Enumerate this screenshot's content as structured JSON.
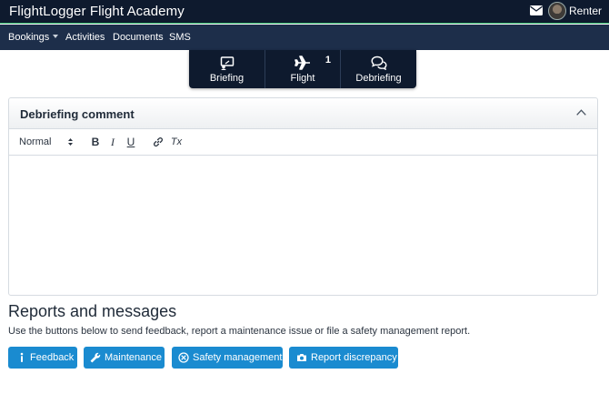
{
  "app": {
    "title": "FlightLogger Flight Academy",
    "user_name": "Renter"
  },
  "nav": {
    "items": [
      {
        "label": "Bookings",
        "has_dropdown": true
      },
      {
        "label": "Activities"
      },
      {
        "label": "Documents"
      },
      {
        "label": "SMS"
      }
    ]
  },
  "tabs": [
    {
      "label": "Briefing",
      "icon": "briefing-icon"
    },
    {
      "label": "Flight",
      "icon": "airplane-icon",
      "count": "1"
    },
    {
      "label": "Debriefing",
      "icon": "chat-icon",
      "active": true
    }
  ],
  "debrief": {
    "title": "Debriefing comment",
    "format_value": "Normal",
    "toolbar": {
      "bold": "B",
      "italic": "I",
      "underline": "U",
      "clear": "Tx"
    },
    "content": ""
  },
  "reports": {
    "title": "Reports and messages",
    "description": "Use the buttons below to send feedback, report a maintenance issue or file a safety management report.",
    "buttons": [
      {
        "label": "Feedback",
        "icon": "info-icon"
      },
      {
        "label": "Maintenance",
        "icon": "wrench-icon"
      },
      {
        "label": "Safety management",
        "icon": "safety-icon"
      },
      {
        "label": "Report discrepancy",
        "icon": "camera-icon"
      }
    ]
  },
  "colors": {
    "topbar": "#0e1a2e",
    "navbar": "#1d2e4a",
    "accent_line": "#2fb56a",
    "button": "#1a8bd0"
  }
}
